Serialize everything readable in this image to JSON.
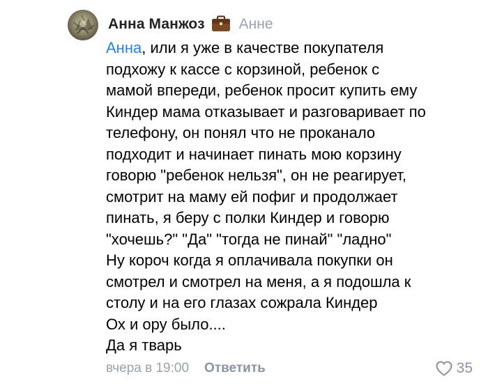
{
  "comment": {
    "author": "Анна Манжоз",
    "reply_to": "Анне",
    "mention": "Анна",
    "first_line_rest": ", или я уже в качестве покупателя",
    "lines": [
      "подхожу к кассе с корзиной, ребенок с",
      "мамой впереди, ребенок просит купить ему",
      "Киндер мама отказывает и разговаривает по",
      "телефону, он понял что не проканало",
      "подходит и начинает пинать мою корзину",
      "говорю \"ребенок нельзя\", он не реагирует,",
      "смотрит на маму ей пофиг и продолжает",
      "пинать, я беру с полки Киндер и говорю",
      "\"хочешь?\" \"Да\" \"тогда не пинай\" \"ладно\"",
      "Ну короч когда я оплачивала покупки он",
      "смотрел и смотрел на меня, а я подошла к",
      "столу и на его глазах сожрала Киндер",
      "Ох и ору было....",
      "Да я тварь"
    ],
    "timestamp": "вчера в 19:00",
    "reply_label": "Ответить",
    "likes": "35",
    "badge_icon": "briefcase-icon",
    "like_icon": "heart-outline-icon"
  },
  "colors": {
    "mention": "#2a80e0",
    "secondary": "#99a2ad",
    "text": "#000000",
    "briefcase": "#7a4a24"
  }
}
